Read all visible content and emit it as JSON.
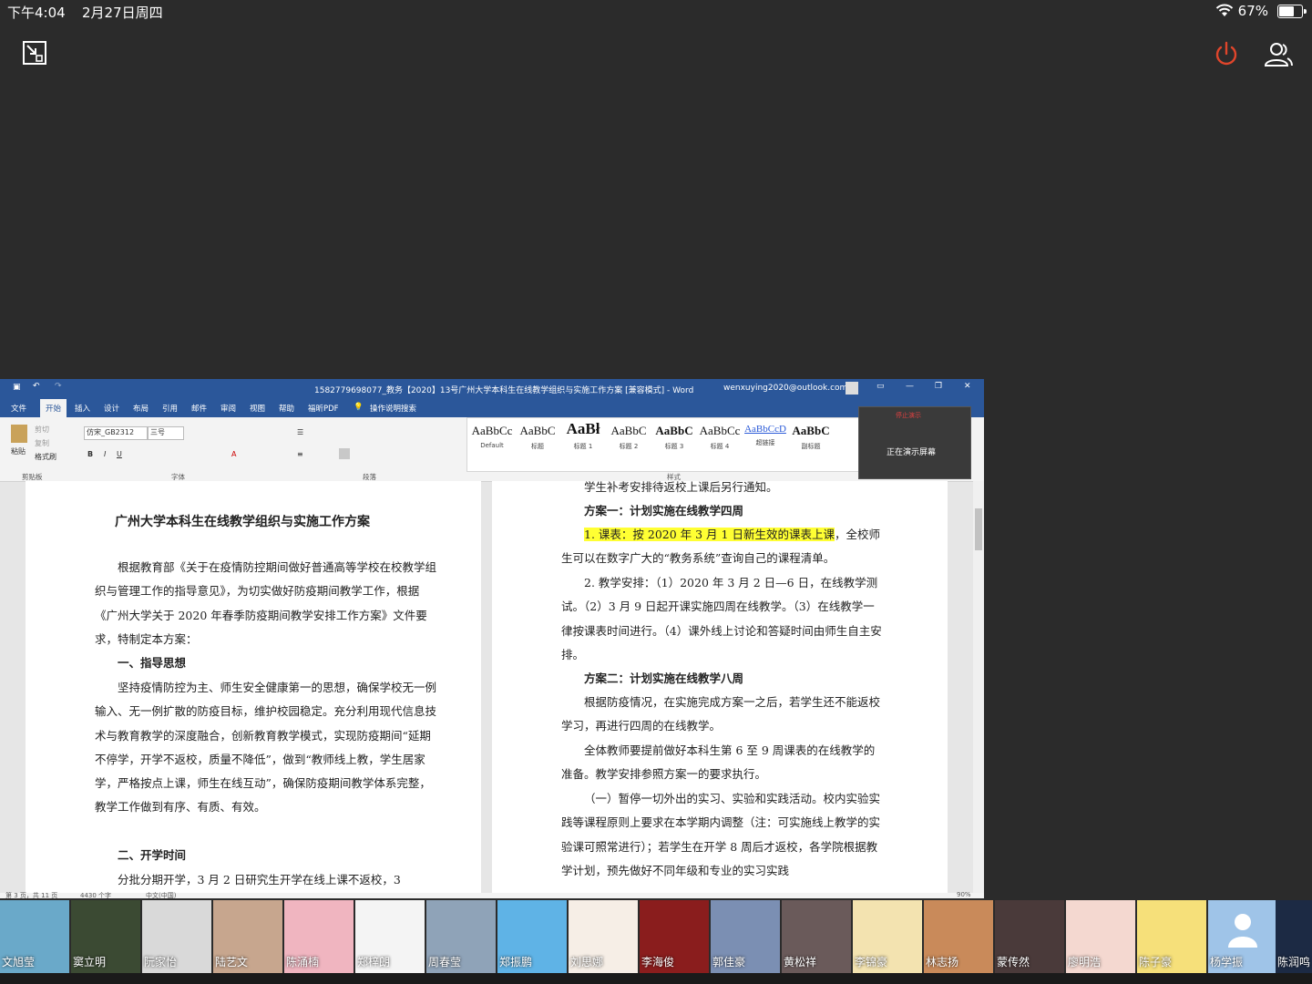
{
  "status_bar": {
    "time": "下午4:04",
    "date": "2月27日周四",
    "battery": "67%"
  },
  "word": {
    "doc_title": "1582779698077_教务【2020】13号广州大学本科生在线教学组织与实施工作方案 [兼容模式] - Word",
    "account": "wenxuying2020@outlook.com",
    "tabs": [
      "文件",
      "开始",
      "插入",
      "设计",
      "布局",
      "引用",
      "邮件",
      "审阅",
      "视图",
      "帮助",
      "福昕PDF",
      "操作说明搜索"
    ],
    "clipboard": {
      "paste": "粘贴",
      "cut": "剪切",
      "copy": "复制",
      "format_painter": "格式刷",
      "label": "剪贴板"
    },
    "font": {
      "name": "仿宋_GB2312",
      "size": "三号",
      "label": "字体"
    },
    "paragraph_label": "段落",
    "styles_label": "样式",
    "styles": [
      {
        "sample": "AaBbCc",
        "name": "Default"
      },
      {
        "sample": "AaBbC",
        "name": "标题"
      },
      {
        "sample": "AaBł",
        "name": "标题 1"
      },
      {
        "sample": "AaBbC",
        "name": "标题 2"
      },
      {
        "sample": "AaBbC",
        "name": "标题 3"
      },
      {
        "sample": "AaBbCc",
        "name": "标题 4"
      },
      {
        "sample": "AaBbCcD",
        "name": "超链接"
      },
      {
        "sample": "AaBbC",
        "name": "副标题"
      }
    ],
    "presenting": {
      "stop": "停止演示",
      "label": "正在演示屏幕"
    },
    "status": {
      "page": "第 3 页，共 11 页",
      "words": "4430 个字",
      "lang": "中文(中国)",
      "zoom": "90%"
    },
    "left_page": {
      "title": "广州大学本科生在线教学组织与实施工作方案",
      "p1": "根据教育部《关于在疫情防控期间做好普通高等学校在校教学组织与管理工作的指导意见》，为切实做好防疫期间教学工作，根据《广州大学关于 2020 年春季防疫期间教学安排工作方案》文件要求，特制定本方案：",
      "h1": "一、指导思想",
      "p2": "坚持疫情防控为主、师生安全健康第一的思想，确保学校无一例输入、无一例扩散的防疫目标，维护校园稳定。充分利用现代信息技术与教育教学的深度融合，创新教育教学模式，实现防疫期间“延期不停学，开学不返校，质量不降低”，做到“教师线上教，学生居家学，严格按点上课，师生在线互动”，确保防疫期间教学体系完整，教学工作做到有序、有质、有效。",
      "h2": "二、开学时间",
      "p3": "分批分期开学，3 月 2 日研究生开学在线上课不返校，3"
    },
    "right_page": {
      "p0": "学生补考安排待返校上课后另行通知。",
      "h1": "方案一：计划实施在线教学四周",
      "p1_hl": "1. 课表：按 2020 年 3 月 1 日新生效的课表上课",
      "p1_rest": "，全校师生可以在数字广大的“教务系统”查询自己的课程清单。",
      "p2": "2. 教学安排：（1）2020 年 3 月 2 日—6 日，在线教学测试。（2）3 月 9 日起开课实施四周在线教学。（3）在线教学一律按课表时间进行。（4）课外线上讨论和答疑时间由师生自主安排。",
      "h2": "方案二：计划实施在线教学八周",
      "p3": "根据防疫情况，在实施完成方案一之后，若学生还不能返校学习，再进行四周的在线教学。",
      "p4": "全体教师要提前做好本科生第 6 至 9 周课表的在线教学的准备。教学安排参照方案一的要求执行。",
      "p5": "（一）暂停一切外出的实习、实验和实践活动。校内实验实践等课程原则上要求在本学期内调整（注：可实施线上教学的实验课可照常进行）；若学生在开学 8 周后才返校，各学院根据教学计划，预先做好不同年级和专业的实习实践"
    }
  },
  "participants": [
    "文旭莹",
    "窦立明",
    "阮家怡",
    "陆艺文",
    "陈涌楠",
    "郑梓朗",
    "周春莹",
    "郑振鹏",
    "刘思娜",
    "李海俊",
    "郭佳豪",
    "黄松祥",
    "李锦豪",
    "林志扬",
    "蒙传然",
    "廖明浩",
    "陈子豪",
    "杨学振",
    "陈润鸣"
  ],
  "colors": {
    "word_blue": "#2b579a",
    "highlight": "#ffff33",
    "power_red": "#e0452b"
  }
}
